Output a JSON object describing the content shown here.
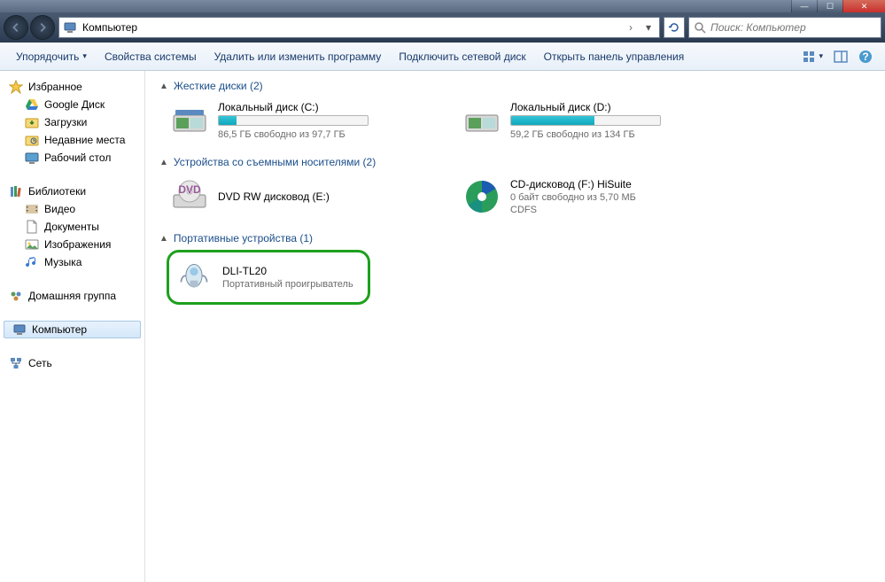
{
  "titlebar": {
    "min": "—",
    "max": "☐",
    "close": "✕"
  },
  "nav": {
    "back": "◀",
    "forward": "▶"
  },
  "address": {
    "path": "Компьютер",
    "sep": "›",
    "drop": "▾",
    "refresh": "↻"
  },
  "search": {
    "placeholder": "Поиск: Компьютер"
  },
  "toolbar": {
    "organize": "Упорядочить",
    "organize_drop": "▾",
    "sysprops": "Свойства системы",
    "addremove": "Удалить или изменить программу",
    "mapdrive": "Подключить сетевой диск",
    "controlpanel": "Открыть панель управления",
    "view_drop": "▾",
    "help": "?"
  },
  "sidebar": {
    "favorites": {
      "label": "Избранное",
      "items": [
        {
          "label": "Google Диск",
          "icon": "gdrive"
        },
        {
          "label": "Загрузки",
          "icon": "downloads"
        },
        {
          "label": "Недавние места",
          "icon": "recent"
        },
        {
          "label": "Рабочий стол",
          "icon": "desktop"
        }
      ]
    },
    "libraries": {
      "label": "Библиотеки",
      "items": [
        {
          "label": "Видео",
          "icon": "video"
        },
        {
          "label": "Документы",
          "icon": "docs"
        },
        {
          "label": "Изображения",
          "icon": "pics"
        },
        {
          "label": "Музыка",
          "icon": "music"
        }
      ]
    },
    "homegroup": {
      "label": "Домашняя группа"
    },
    "computer": {
      "label": "Компьютер"
    },
    "network": {
      "label": "Сеть"
    }
  },
  "main": {
    "sec1": {
      "title": "Жесткие диски (2)",
      "drives": [
        {
          "name": "Локальный диск (C:)",
          "free": "86,5 ГБ свободно из 97,7 ГБ",
          "fill": 12
        },
        {
          "name": "Локальный диск (D:)",
          "free": "59,2 ГБ свободно из 134 ГБ",
          "fill": 56
        }
      ]
    },
    "sec2": {
      "title": "Устройства со съемными носителями (2)",
      "items": [
        {
          "name": "DVD RW дисковод (E:)",
          "sub1": "",
          "sub2": ""
        },
        {
          "name": "CD-дисковод (F:) HiSuite",
          "sub1": "0 байт свободно из 5,70 МБ",
          "sub2": "CDFS"
        }
      ]
    },
    "sec3": {
      "title": "Портативные устройства (1)",
      "items": [
        {
          "name": "DLI-TL20",
          "sub": "Портативный проигрыватель"
        }
      ]
    }
  }
}
